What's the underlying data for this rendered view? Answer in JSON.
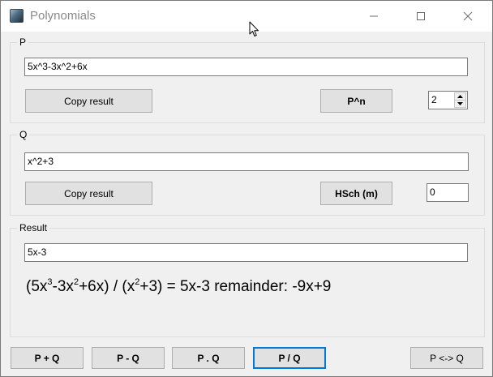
{
  "window": {
    "title": "Polynomials"
  },
  "p_group": {
    "label": "P",
    "input_value": "5x^3-3x^2+6x",
    "copy_label": "Copy result",
    "power_label": "P^n",
    "power_value": "2"
  },
  "q_group": {
    "label": "Q",
    "input_value": "x^2+3",
    "copy_label": "Copy result",
    "hsch_label": "HSch (m)",
    "hsch_value": "0"
  },
  "result_group": {
    "label": "Result",
    "input_value": "5x-3",
    "expression": {
      "open_paren": "(5x",
      "p_exp1": "3",
      "p_mid": "-3x",
      "p_exp2": "2",
      "p_end": "+6x) / (x",
      "q_exp": "2",
      "q_end": "+3) = 5x-3 remainder: -9x+9"
    }
  },
  "operations": {
    "add_label": "P + Q",
    "sub_label": "P - Q",
    "mul_label": "P . Q",
    "div_label": "P / Q",
    "swap_label": "P <-> Q"
  },
  "icons": {
    "app": "app-icon",
    "minimize": "minimize-icon",
    "maximize": "maximize-icon",
    "close": "close-icon",
    "spin_up": "spin-up-icon",
    "spin_down": "spin-down-icon",
    "cursor": "mouse-cursor-icon"
  },
  "colors": {
    "window_bg": "#f0f0f0",
    "titlebar_bg": "#ffffff",
    "button_bg": "#e1e1e1",
    "default_button_border": "#0078d7"
  }
}
